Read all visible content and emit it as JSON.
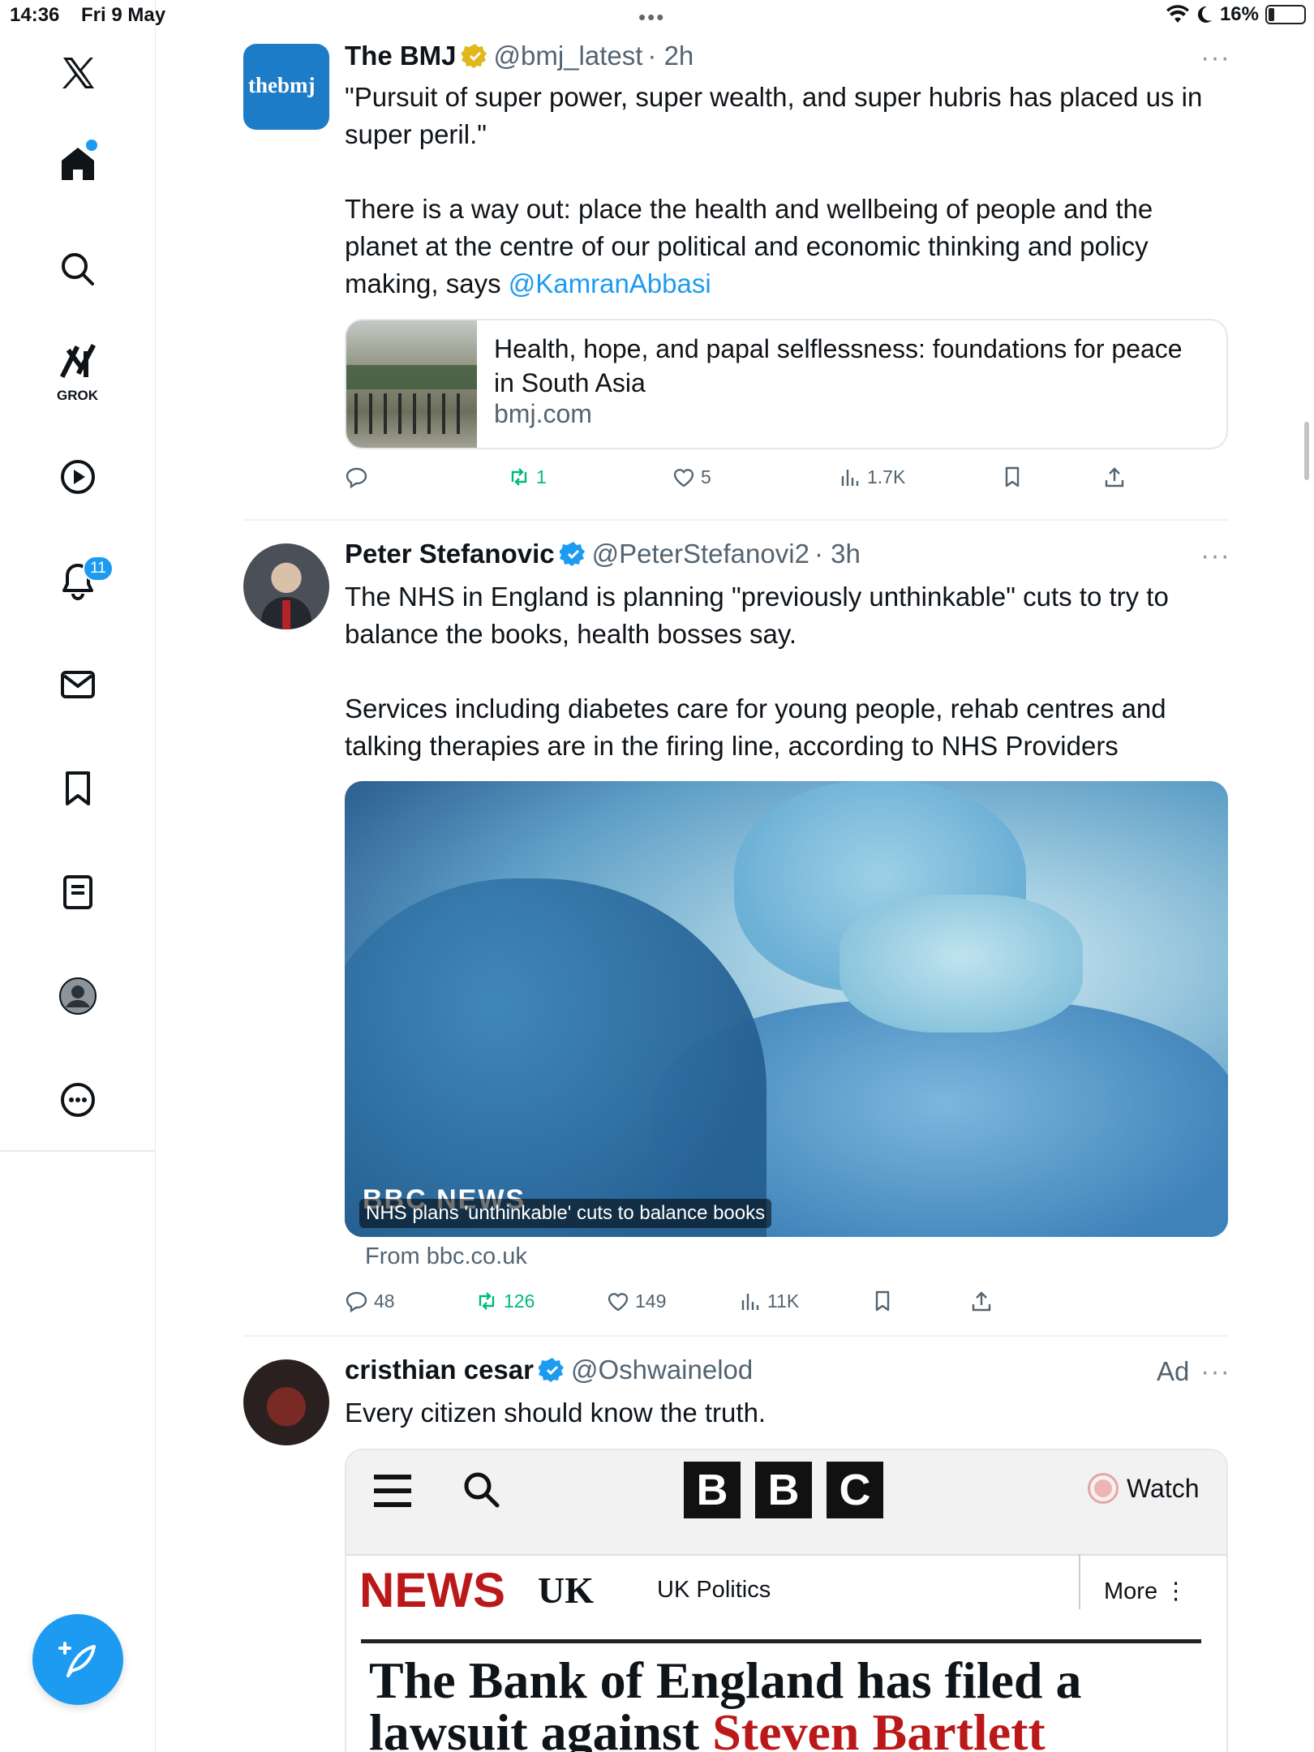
{
  "status_bar": {
    "time": "14:36",
    "date": "Fri 9 May",
    "battery": "16%",
    "battery_level": 0.16
  },
  "sidebar": {
    "grok_label": "GROK",
    "notification_count": "11"
  },
  "tweets": [
    {
      "name": "The BMJ",
      "handle": "@bmj_latest",
      "time": "· 2h",
      "avatar_text": "thebmj",
      "text1": "\"Pursuit of super power, super wealth, and super hubris has placed us in super peril.\"",
      "text2": "There is a way out: place the health and wellbeing of people and the planet at the centre of our political and economic thinking and policy making, says ",
      "mention": "@KamranAbbasi",
      "card": {
        "title": "Health, hope, and papal selflessness: foundations for peace in South Asia",
        "domain": "bmj.com"
      },
      "stats": {
        "replies": "",
        "retweets": "1",
        "likes": "5",
        "views": "1.7K"
      }
    },
    {
      "name": "Peter Stefanovic",
      "handle": "@PeterStefanovi2",
      "time": "· 3h",
      "text1": "The NHS in England is planning \"previously unthinkable\" cuts to try to balance the books, health bosses say.",
      "text2": "Services including diabetes care for young people, rehab centres and talking therapies are in the firing line, according to NHS Providers",
      "media": {
        "watermark": "BBC NEWS",
        "caption": "NHS plans 'unthinkable' cuts to balance books",
        "from": "From bbc.co.uk"
      },
      "stats": {
        "replies": "48",
        "retweets": "126",
        "likes": "149",
        "views": "11K"
      }
    },
    {
      "name": "cristhian cesar",
      "handle": "@Oshwainelod",
      "ad": "Ad",
      "text1": "Every citizen should know the truth.",
      "preview": {
        "logo": [
          "B",
          "B",
          "C"
        ],
        "watch": "Watch",
        "news": "NEWS",
        "uk": "UK",
        "uk_politics": "UK Politics",
        "more": "More ⋮",
        "headline_black": "The Bank of England has filed a lawsuit against ",
        "headline_red": "Steven Bartlett"
      }
    }
  ],
  "more_glyph": "···",
  "colors": {
    "accent": "#1d9bf0",
    "retweet": "#00ba7c",
    "gold": "#e2b719",
    "bbc_red": "#bb1919"
  }
}
